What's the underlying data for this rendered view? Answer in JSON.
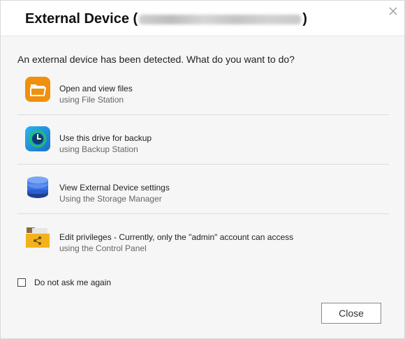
{
  "dialog": {
    "title_prefix": "External Device (",
    "title_suffix": ")",
    "prompt": "An external device has been detected. What do you want to do?",
    "options": [
      {
        "label": "Open and view files",
        "sublabel": "using File Station",
        "icon": "folder-icon"
      },
      {
        "label": "Use this drive for backup",
        "sublabel": "using Backup Station",
        "icon": "backup-clock-icon"
      },
      {
        "label": "View External Device settings",
        "sublabel": "Using the Storage Manager",
        "icon": "storage-disk-icon"
      },
      {
        "label": "Edit privileges - Currently, only the \"admin\" account can access",
        "sublabel": "using the Control Panel",
        "icon": "shared-folder-icon"
      }
    ],
    "checkbox_label": "Do not ask me again",
    "close_button": "Close",
    "colors": {
      "folder": "#f0900f",
      "backup": "#1a8ed8",
      "storage": "#2a5fd0",
      "shared": "#f2b21b"
    }
  }
}
